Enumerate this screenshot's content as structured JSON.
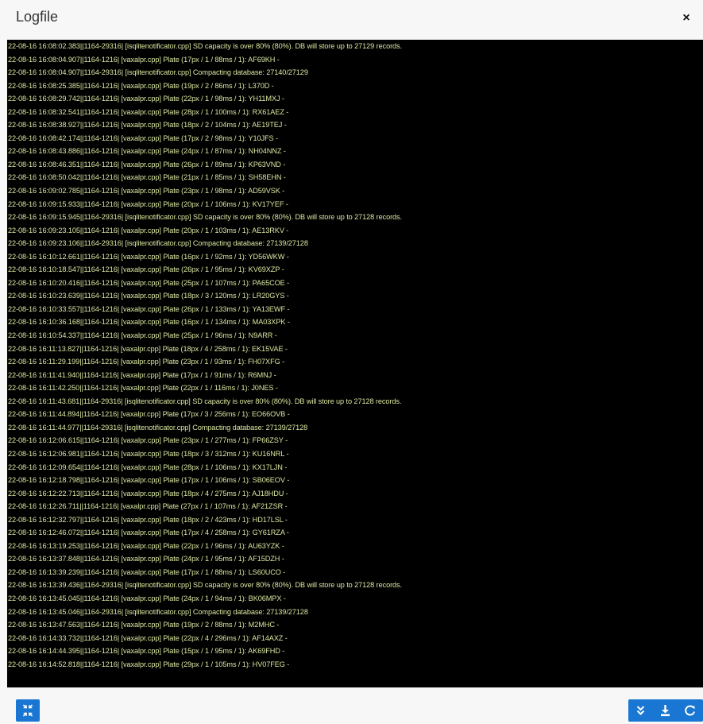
{
  "dialog": {
    "title": "Logfile",
    "close_glyph": "×"
  },
  "colors": {
    "log_background": "#000000",
    "log_text": "#d8e8a0",
    "accent": "#1976d2"
  },
  "log_lines": [
    "22-08-16 16:08:02.383||1164-29316| [isqlitenotificator.cpp] SD capacity is over 80% (80%). DB will store up to 27129 records.",
    "22-08-16 16:08:04.907||1164-1216| [vaxalpr.cpp] Plate (17px / 1 / 88ms / 1): AF69KH -",
    "22-08-16 16:08:04.907||1164-29316| [isqlitenotificator.cpp] Compacting database: 27140/27129",
    "22-08-16 16:08:25.385||1164-1216| [vaxalpr.cpp] Plate (19px / 2 / 86ms / 1): L370D -",
    "22-08-16 16:08:29.742||1164-1216| [vaxalpr.cpp] Plate (22px / 1 / 98ms / 1): YH11MXJ -",
    "22-08-16 16:08:32.541||1164-1216| [vaxalpr.cpp] Plate (28px / 1 / 100ms / 1): RX61AEZ -",
    "22-08-16 16:08:38.927||1164-1216| [vaxalpr.cpp] Plate (18px / 2 / 104ms / 1): AE19TEJ -",
    "22-08-16 16:08:42.174||1164-1216| [vaxalpr.cpp] Plate (17px / 2 / 98ms / 1): Y10JFS -",
    "22-08-16 16:08:43.886||1164-1216| [vaxalpr.cpp] Plate (24px / 1 / 87ms / 1): NH04NNZ -",
    "22-08-16 16:08:46.351||1164-1216| [vaxalpr.cpp] Plate (26px / 1 / 89ms / 1): KP63VND -",
    "22-08-16 16:08:50.042||1164-1216| [vaxalpr.cpp] Plate (21px / 1 / 85ms / 1): SH58EHN -",
    "22-08-16 16:09:02.785||1164-1216| [vaxalpr.cpp] Plate (23px / 1 / 98ms / 1): AD59VSK -",
    "22-08-16 16:09:15.933||1164-1216| [vaxalpr.cpp] Plate (20px / 1 / 106ms / 1): KV17YEF -",
    "22-08-16 16:09:15.945||1164-29316| [isqlitenotificator.cpp] SD capacity is over 80% (80%). DB will store up to 27128 records.",
    "22-08-16 16:09:23.105||1164-1216| [vaxalpr.cpp] Plate (20px / 1 / 103ms / 1): AE13RKV -",
    "22-08-16 16:09:23.106||1164-29316| [isqlitenotificator.cpp] Compacting database: 27139/27128",
    "22-08-16 16:10:12.661||1164-1216| [vaxalpr.cpp] Plate (16px / 1 / 92ms / 1): YD56WKW -",
    "22-08-16 16:10:18.547||1164-1216| [vaxalpr.cpp] Plate (26px / 1 / 95ms / 1): KV69XZP -",
    "22-08-16 16:10:20.416||1164-1216| [vaxalpr.cpp] Plate (25px / 1 / 107ms / 1): PA65COE -",
    "22-08-16 16:10:23.639||1164-1216| [vaxalpr.cpp] Plate (18px / 3 / 120ms / 1): LR20GYS -",
    "22-08-16 16:10:33.557||1164-1216| [vaxalpr.cpp] Plate (26px / 1 / 133ms / 1): YA13EWF -",
    "22-08-16 16:10:36.168||1164-1216| [vaxalpr.cpp] Plate (16px / 1 / 134ms / 1): MA03XPK -",
    "22-08-16 16:10:54.337||1164-1216| [vaxalpr.cpp] Plate (25px / 1 / 96ms / 1): N9ARR -",
    "22-08-16 16:11:13.827||1164-1216| [vaxalpr.cpp] Plate (18px / 4 / 258ms / 1): EK15VAE -",
    "22-08-16 16:11:29.199||1164-1216| [vaxalpr.cpp] Plate (23px / 1 / 93ms / 1): FH07XFG -",
    "22-08-16 16:11:41.940||1164-1216| [vaxalpr.cpp] Plate (17px / 1 / 91ms / 1): R6MNJ -",
    "22-08-16 16:11:42.250||1164-1216| [vaxalpr.cpp] Plate (22px / 1 / 116ms / 1): J0NES -",
    "22-08-16 16:11:43.681||1164-29316| [isqlitenotificator.cpp] SD capacity is over 80% (80%). DB will store up to 27128 records.",
    "22-08-16 16:11:44.894||1164-1216| [vaxalpr.cpp] Plate (17px / 3 / 256ms / 1): EO66OVB -",
    "22-08-16 16:11:44.977||1164-29316| [isqlitenotificator.cpp] Compacting database: 27139/27128",
    "22-08-16 16:12:06.615||1164-1216| [vaxalpr.cpp] Plate (23px / 1 / 277ms / 1): FP66ZSY -",
    "22-08-16 16:12:06.981||1164-1216| [vaxalpr.cpp] Plate (18px / 3 / 312ms / 1): KU16NRL -",
    "22-08-16 16:12:09.654||1164-1216| [vaxalpr.cpp] Plate (28px / 1 / 106ms / 1): KX17LJN -",
    "22-08-16 16:12:18.798||1164-1216| [vaxalpr.cpp] Plate (17px / 1 / 106ms / 1): SB06EOV -",
    "22-08-16 16:12:22.713||1164-1216| [vaxalpr.cpp] Plate (18px / 4 / 275ms / 1): AJ18HDU -",
    "22-08-16 16:12:26.711||1164-1216| [vaxalpr.cpp] Plate (27px / 1 / 107ms / 1): AF21ZSR -",
    "22-08-16 16:12:32.797||1164-1216| [vaxalpr.cpp] Plate (18px / 2 / 423ms / 1): HD17LSL -",
    "22-08-16 16:12:46.072||1164-1216| [vaxalpr.cpp] Plate (17px / 4 / 258ms / 1): GY61RZA -",
    "22-08-16 16:13:19.253||1164-1216| [vaxalpr.cpp] Plate (22px / 1 / 96ms / 1): AU63YZK -",
    "22-08-16 16:13:37.848||1164-1216| [vaxalpr.cpp] Plate (24px / 1 / 95ms / 1): AF15DZH -",
    "22-08-16 16:13:39.239||1164-1216| [vaxalpr.cpp] Plate (17px / 1 / 88ms / 1): LS60UCO -",
    "22-08-16 16:13:39.436||1164-29316| [isqlitenotificator.cpp] SD capacity is over 80% (80%). DB will store up to 27128 records.",
    "22-08-16 16:13:45.045||1164-1216| [vaxalpr.cpp] Plate (24px / 1 / 94ms / 1): BK06MPX -",
    "22-08-16 16:13:45.046||1164-29316| [isqlitenotificator.cpp] Compacting database: 27139/27128",
    "22-08-16 16:13:47.563||1164-1216| [vaxalpr.cpp] Plate (19px / 2 / 88ms / 1): M2MHC -",
    "22-08-16 16:14:33.732||1164-1216| [vaxalpr.cpp] Plate (22px / 4 / 296ms / 1): AF14AXZ -",
    "22-08-16 16:14:44.395||1164-1216| [vaxalpr.cpp] Plate (15px / 1 / 95ms / 1): AK69FHD -",
    "22-08-16 16:14:52.818||1164-1216| [vaxalpr.cpp] Plate (29px / 1 / 105ms / 1): HV07FEG -"
  ],
  "footer": {
    "left_buttons": [
      {
        "icon": "collapse-icon"
      }
    ],
    "right_buttons": [
      {
        "icon": "scroll-to-bottom-icon"
      },
      {
        "icon": "download-icon"
      },
      {
        "icon": "refresh-icon"
      }
    ]
  }
}
